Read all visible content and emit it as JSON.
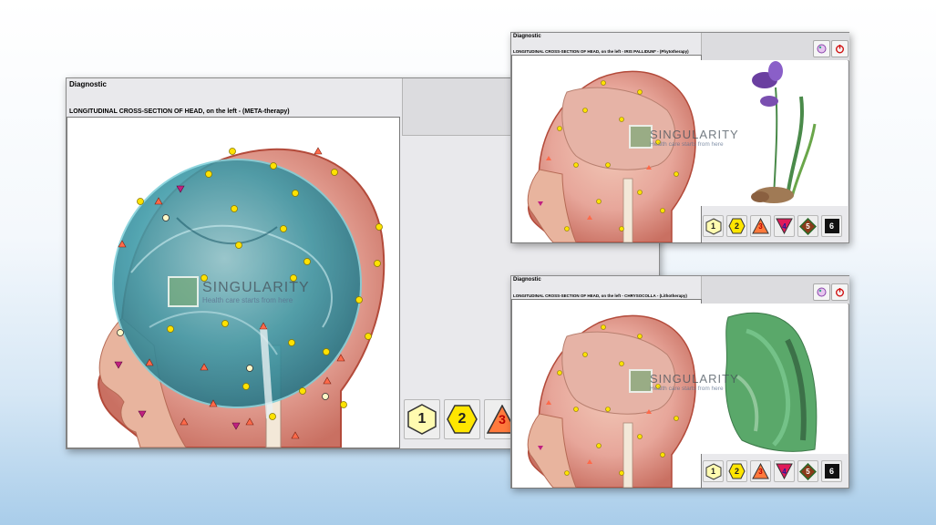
{
  "main_window": {
    "title": "Diagnostic",
    "subtitle": "LONGITUDINAL CROSS-SECTION OF HEAD, on the left - (META-therapy)",
    "buttons": [
      "1",
      "2",
      "3"
    ]
  },
  "top_right_window": {
    "title": "Diagnostic",
    "subtitle": "LONGITUDINAL CROSS-SECTION OF HEAD, on the left - IRIS PALLIDUM* - (Phytotherapy)",
    "buttons": [
      "1",
      "2",
      "3",
      "4",
      "5",
      "6"
    ],
    "tools": {
      "palette": "palette-icon",
      "power": "power-icon"
    }
  },
  "bottom_right_window": {
    "title": "Diagnostic",
    "subtitle": "LONGITUDINAL CROSS-SECTION OF HEAD, on the left - CHRYSOCOLLA - (Lithotherapy)",
    "buttons": [
      "1",
      "2",
      "3",
      "4",
      "5",
      "6"
    ],
    "tools": {
      "palette": "palette-icon",
      "power": "power-icon"
    }
  },
  "watermark": {
    "brand": "SINGULARITY",
    "tagline": "Health care starts from here"
  },
  "colors": {
    "level1": "#fffbb0",
    "level2": "#ffe600",
    "level3": "#ff7a3c",
    "level4": "#e01a5a",
    "level5": "#8a3a1a",
    "level6": "#111111"
  }
}
